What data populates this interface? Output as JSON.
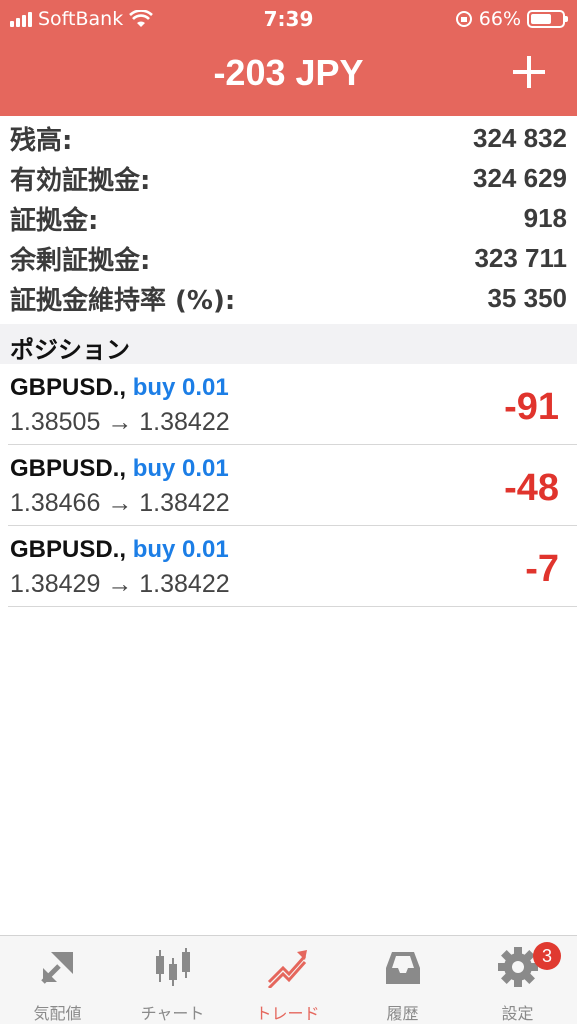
{
  "status_bar": {
    "carrier": "SoftBank",
    "time": "7:39",
    "battery": "66%",
    "battery_level": 0.66
  },
  "header": {
    "title": "-203 JPY"
  },
  "summary": [
    {
      "label": "残高:",
      "value": "324 832"
    },
    {
      "label": "有効証拠金:",
      "value": "324 629"
    },
    {
      "label": "証拠金:",
      "value": "918"
    },
    {
      "label": "余剰証拠金:",
      "value": "323 711"
    },
    {
      "label": "証拠金維持率 (%):",
      "value": "35 350"
    }
  ],
  "positions_header": "ポジション",
  "positions": [
    {
      "symbol": "GBPUSD.,",
      "side": "buy 0.01",
      "prices": "1.38505 → 1.38422",
      "profit": "-91"
    },
    {
      "symbol": "GBPUSD.,",
      "side": "buy 0.01",
      "prices": "1.38466 → 1.38422",
      "profit": "-48"
    },
    {
      "symbol": "GBPUSD.,",
      "side": "buy 0.01",
      "prices": "1.38429 → 1.38422",
      "profit": "-7"
    }
  ],
  "tabs": [
    {
      "label": "気配値",
      "icon": "quotes-icon"
    },
    {
      "label": "チャート",
      "icon": "chart-icon"
    },
    {
      "label": "トレード",
      "icon": "trade-icon",
      "active": true
    },
    {
      "label": "履歴",
      "icon": "history-icon"
    },
    {
      "label": "設定",
      "icon": "gear-icon"
    }
  ],
  "settings_badge": "3",
  "colors": {
    "accent": "#e5675d",
    "profit_negative": "#e0342d",
    "buy_blue": "#1c7ee6"
  }
}
